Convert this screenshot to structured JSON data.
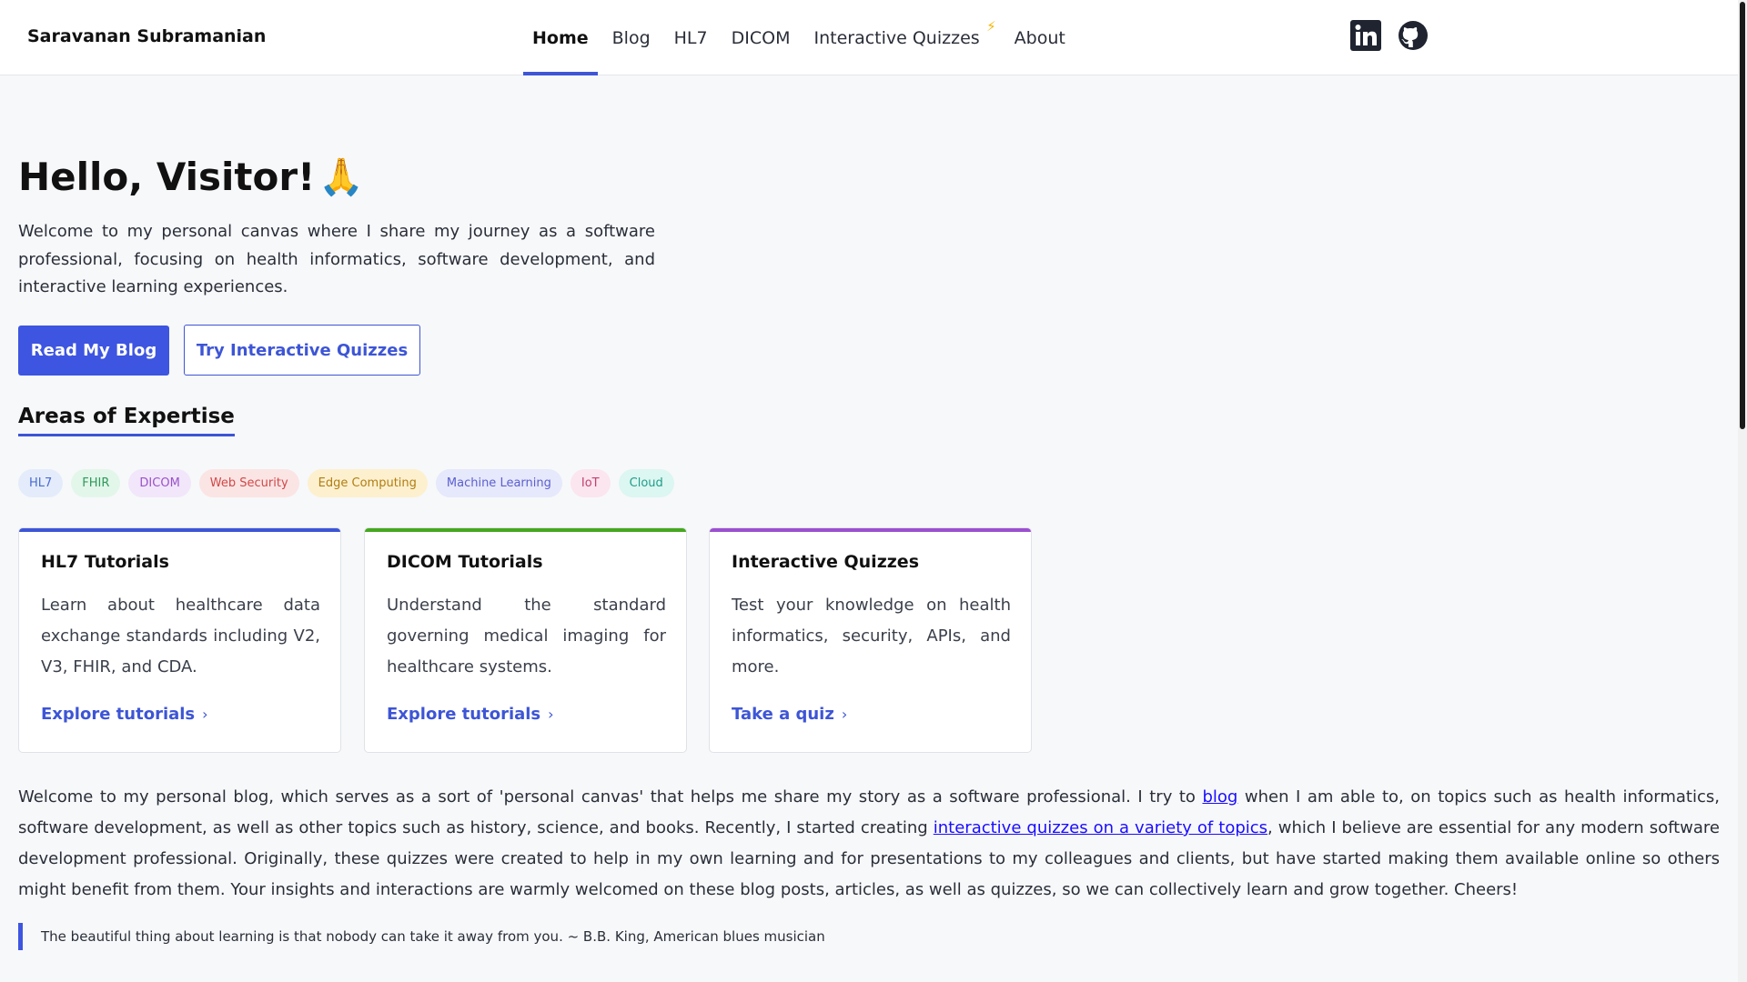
{
  "header": {
    "brand": "Saravanan Subramanian",
    "nav": [
      {
        "label": "Home"
      },
      {
        "label": "Blog"
      },
      {
        "label": "HL7"
      },
      {
        "label": "DICOM"
      },
      {
        "label": "Interactive Quizzes"
      },
      {
        "label": "About"
      }
    ],
    "social_icons": [
      "linkedin-icon",
      "github-icon"
    ]
  },
  "hero": {
    "title": "Hello, Visitor!",
    "intro": "Welcome to my personal canvas where I share my journey as a software professional, focusing on health informatics, software development, and interactive learning experiences.",
    "primary_button": "Read My Blog",
    "secondary_button": "Try Interactive Quizzes"
  },
  "expertise": {
    "title": "Areas of Expertise",
    "tags": [
      {
        "label": "HL7",
        "bg": "#e4ecfb",
        "fg": "#4a6bd1"
      },
      {
        "label": "FHIR",
        "bg": "#e3f6ea",
        "fg": "#2f9a5a"
      },
      {
        "label": "DICOM",
        "bg": "#f1e6fa",
        "fg": "#9a52c9"
      },
      {
        "label": "Web Security",
        "bg": "#fbe4e4",
        "fg": "#d04848"
      },
      {
        "label": "Edge Computing",
        "bg": "#fdf0cf",
        "fg": "#b07d10"
      },
      {
        "label": "Machine Learning",
        "bg": "#e6e8fb",
        "fg": "#5a5fcf"
      },
      {
        "label": "IoT",
        "bg": "#fbe5ee",
        "fg": "#c2416f"
      },
      {
        "label": "Cloud",
        "bg": "#dcf6f1",
        "fg": "#1f9d8a"
      }
    ]
  },
  "cards": [
    {
      "title": "HL7 Tutorials",
      "text": "Learn about healthcare data exchange standards including V2, V3, FHIR, and CDA.",
      "link": "Explore tutorials",
      "accent": "#3d55d6"
    },
    {
      "title": "DICOM Tutorials",
      "text": "Understand the standard governing medical imaging for healthcare systems.",
      "link": "Explore tutorials",
      "accent": "#45a81e"
    },
    {
      "title": "Interactive Quizzes",
      "text": "Test your knowledge on health informatics, security, APIs, and more.",
      "link": "Take a quiz",
      "accent": "#9b4fd0"
    }
  ],
  "about": {
    "part1": "Welcome to my personal blog, which serves as a sort of 'personal canvas' that helps me share my story as a software professional. I try to ",
    "link1": "blog",
    "part2": " when I am able to, on topics such as health informatics, software development, as well as other topics such as history, science, and books. Recently, I started creating ",
    "link2": "interactive quizzes on a variety of topics",
    "part3": ", which I believe are essential for any modern software development professional. Originally, these quizzes were created to help in my own learning and for presentations to my colleagues and clients, but have started making them available online so others might benefit from them. Your insights and interactions are warmly welcomed on these blog posts, articles, as well as quizzes, so we can collectively learn and grow together. Cheers!"
  },
  "quote": "The beautiful thing about learning is that nobody can take it away from you. ~ B.B. King, American blues musician"
}
